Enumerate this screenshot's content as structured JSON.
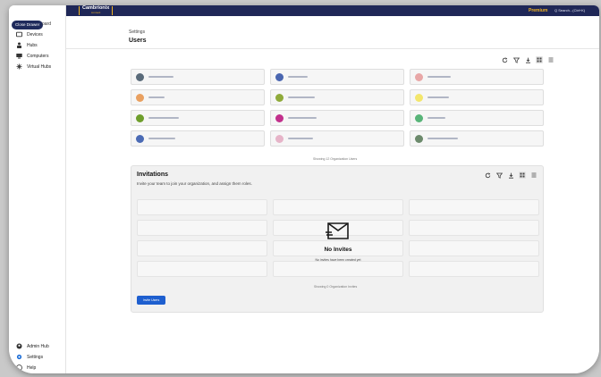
{
  "app": {
    "brand": "Cambrionix",
    "brand_sub": "connect",
    "premium": "Premium",
    "search": "Q Search...(Ctrl+K)"
  },
  "sidebar": {
    "drawer_label": "Close Drawer",
    "drawer_trail": "oard",
    "items": [
      {
        "label": "Devices",
        "icon": "devices-icon"
      },
      {
        "label": "Hubs",
        "icon": "hub-icon"
      },
      {
        "label": "Computers",
        "icon": "computer-icon"
      },
      {
        "label": "Virtual Hubs",
        "icon": "virtual-hub-icon"
      }
    ],
    "bottom_items": [
      {
        "label": "Admin Hub",
        "icon": "admin-icon"
      },
      {
        "label": "Settings",
        "icon": "gear-icon"
      },
      {
        "label": "Help",
        "icon": "help-icon"
      }
    ]
  },
  "page": {
    "breadcrumb": "Settings",
    "title": "Users"
  },
  "users": {
    "showing": "Showing 12 Organization Users",
    "avatar_colors": [
      "#5a6b7a",
      "#4a66b0",
      "#e8a7a7",
      "#e9a060",
      "#8faa3a",
      "#f3e66c",
      "#6e9e2c",
      "#c2308c",
      "#58b478",
      "#4b6bb5",
      "#e6b4c8",
      "#6c8a6c"
    ]
  },
  "invitations": {
    "title": "Invitations",
    "subtitle": "Invite your team to join your organization, and assign them roles.",
    "empty_title": "No Invites",
    "empty_sub": "No invites have been created yet",
    "showing": "Showing 0 Organization Invites",
    "invite_button": "Invite Users"
  },
  "colors": {
    "topbar": "#1f2757",
    "brand_accent": "#f0b323",
    "primary_button": "#1e5fcf"
  }
}
